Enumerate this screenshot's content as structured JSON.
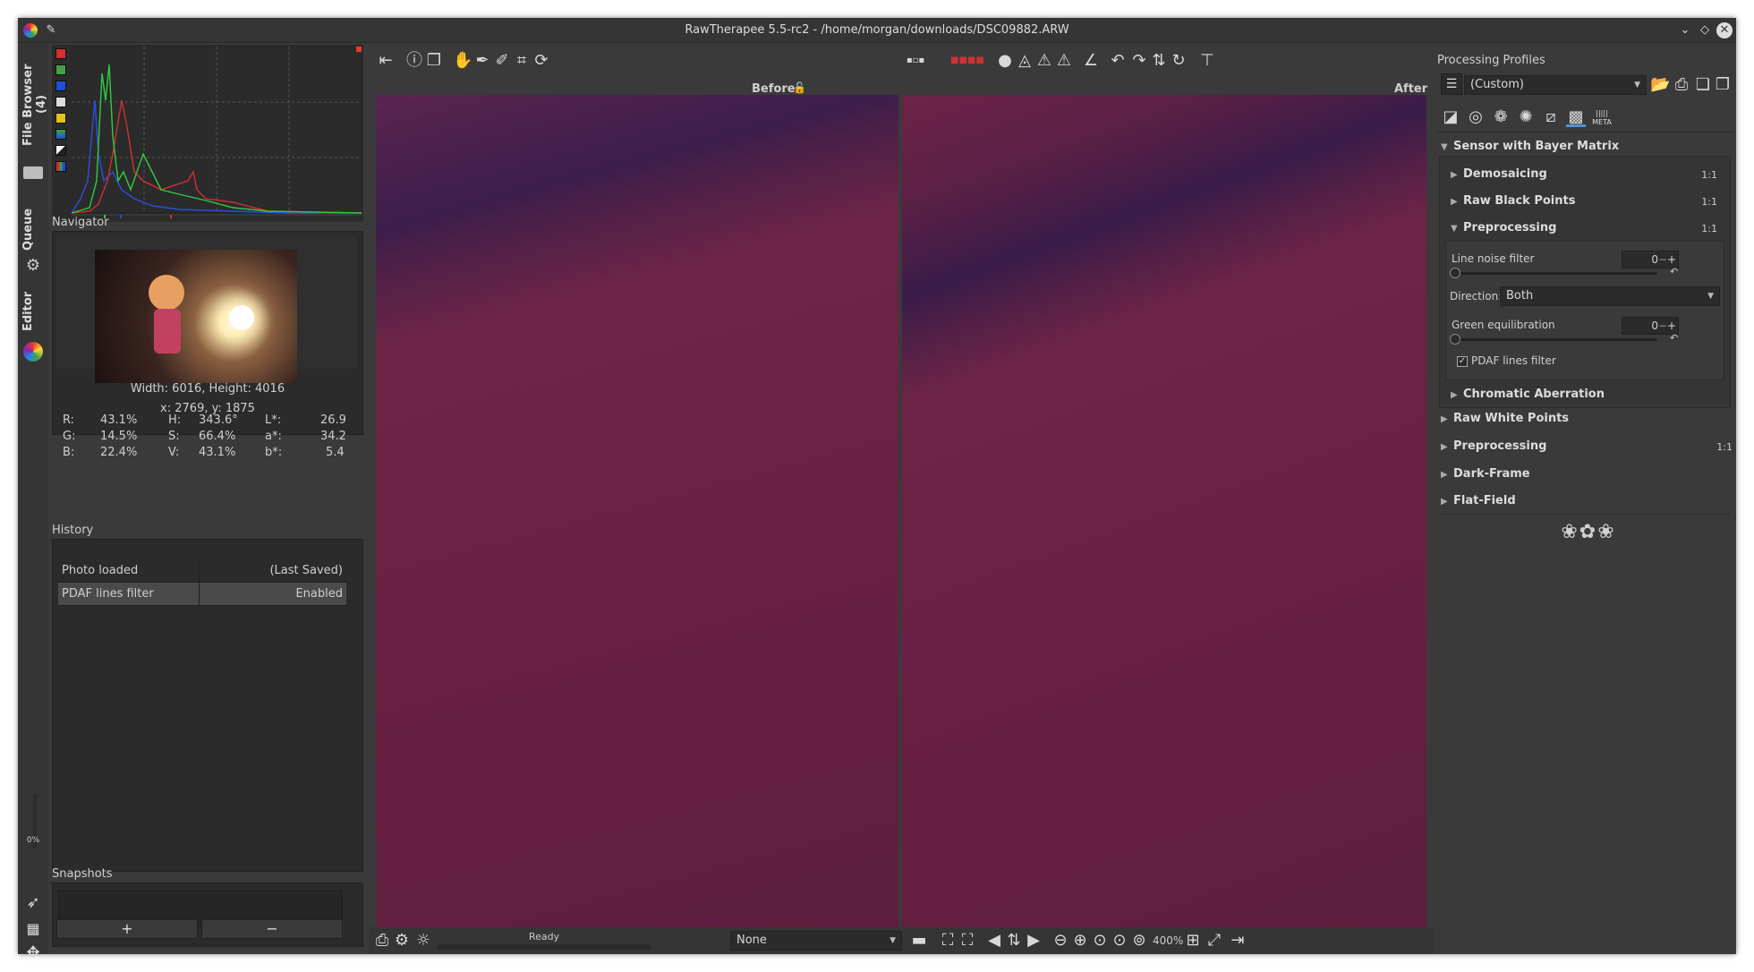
{
  "window": {
    "title": "RawTherapee 5.5-rc2 - /home/morgan/downloads/DSC09882.ARW"
  },
  "vtabs": {
    "file_browser": "File Browser (4)",
    "queue": "Queue",
    "editor": "Editor",
    "progress": "0%"
  },
  "navigator": {
    "title": "Navigator",
    "size": "Width: 6016, Height: 4016",
    "coords": "x: 2769, y: 1875",
    "values": {
      "r_l": "R:",
      "r": "43.1%",
      "h_l": "H:",
      "h": "343.6°",
      "l_l": "L*:",
      "l": "26.9",
      "g_l": "G:",
      "g": "14.5%",
      "s_l": "S:",
      "s": "66.4%",
      "a_l": "a*:",
      "a": "34.2",
      "b_l": "B:",
      "b": "22.4%",
      "v_l": "V:",
      "v": "43.1%",
      "bb_l": "b*:",
      "bb": "5.4"
    }
  },
  "history": {
    "title": "History",
    "rows": [
      {
        "name": "Photo loaded",
        "value": "(Last Saved)"
      },
      {
        "name": "PDAF lines filter",
        "value": "Enabled"
      }
    ]
  },
  "snapshots": {
    "title": "Snapshots",
    "add": "+",
    "remove": "−"
  },
  "center": {
    "before": "Before",
    "after": "After"
  },
  "bottombar": {
    "status": "Ready",
    "profile_select": "None",
    "zoom": "400%"
  },
  "right": {
    "profiles_title": "Processing Profiles",
    "profile_value": "(Custom)",
    "sensor_section": "Sensor with Bayer Matrix",
    "demosaicing": "Demosaicing",
    "raw_black": "Raw Black Points",
    "preprocessing": "Preprocessing",
    "line_noise": "Line noise filter",
    "line_noise_val": "0",
    "direction_label": "Direction:",
    "direction_val": "Both",
    "green_eq": "Green equilibration",
    "green_eq_val": "0",
    "pdaf": "PDAF lines filter",
    "chromatic": "Chromatic Aberration",
    "raw_white": "Raw White Points",
    "preprocessing2": "Preprocessing",
    "dark_frame": "Dark-Frame",
    "flat_field": "Flat-Field",
    "ratio": "1:1",
    "meta_tab": "META"
  },
  "colors": {
    "accent_blue": "#5a8fd8",
    "bg": "#3a3a3a",
    "panel": "#2b2b2b"
  }
}
